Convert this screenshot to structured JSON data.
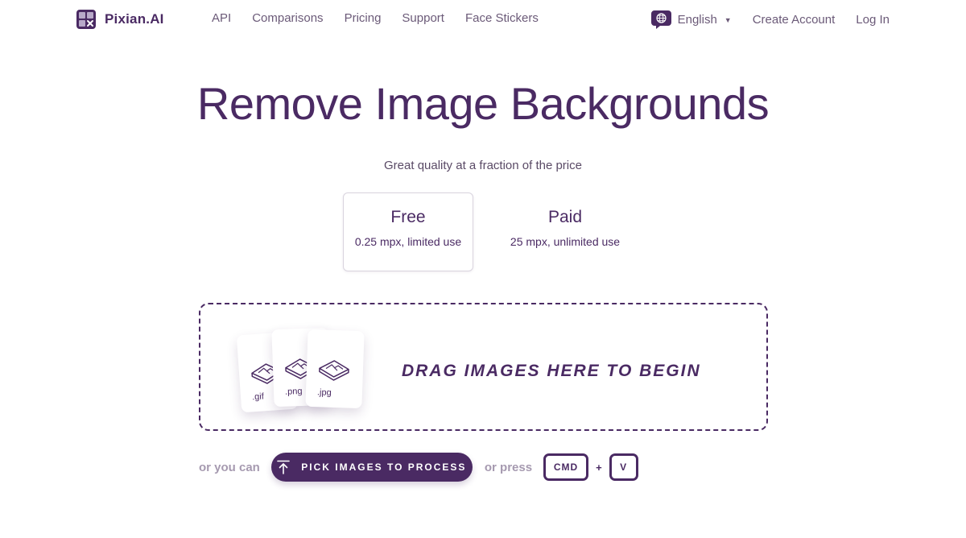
{
  "brand": {
    "name": "Pixian.AI"
  },
  "nav": {
    "links": [
      "API",
      "Comparisons",
      "Pricing",
      "Support",
      "Face Stickers"
    ],
    "language": "English",
    "create_account": "Create Account",
    "log_in": "Log In"
  },
  "hero": {
    "title": "Remove Image Backgrounds",
    "subtitle": "Great quality at a fraction of the price"
  },
  "plans": [
    {
      "name": "Free",
      "desc": "0.25 mpx, limited use",
      "selected": true
    },
    {
      "name": "Paid",
      "desc": "25 mpx, unlimited use",
      "selected": false
    }
  ],
  "dropzone": {
    "text": "DRAG IMAGES HERE TO BEGIN",
    "files": [
      ".gif",
      ".png",
      ".jpg"
    ]
  },
  "actions": {
    "or_you_can": "or you can",
    "pick_button": "PICK IMAGES TO PROCESS",
    "or_press": "or press",
    "key_cmd": "CMD",
    "plus": "+",
    "key_v": "V"
  },
  "icons": {
    "logo": "pixian-logo-icon",
    "language": "globe-chat-icon",
    "upload": "upload-arrow-icon",
    "image_file": "image-file-icon"
  },
  "colors": {
    "brand": "#4a2a63",
    "muted": "#a69ab0",
    "nav_text": "#6b5a78"
  }
}
